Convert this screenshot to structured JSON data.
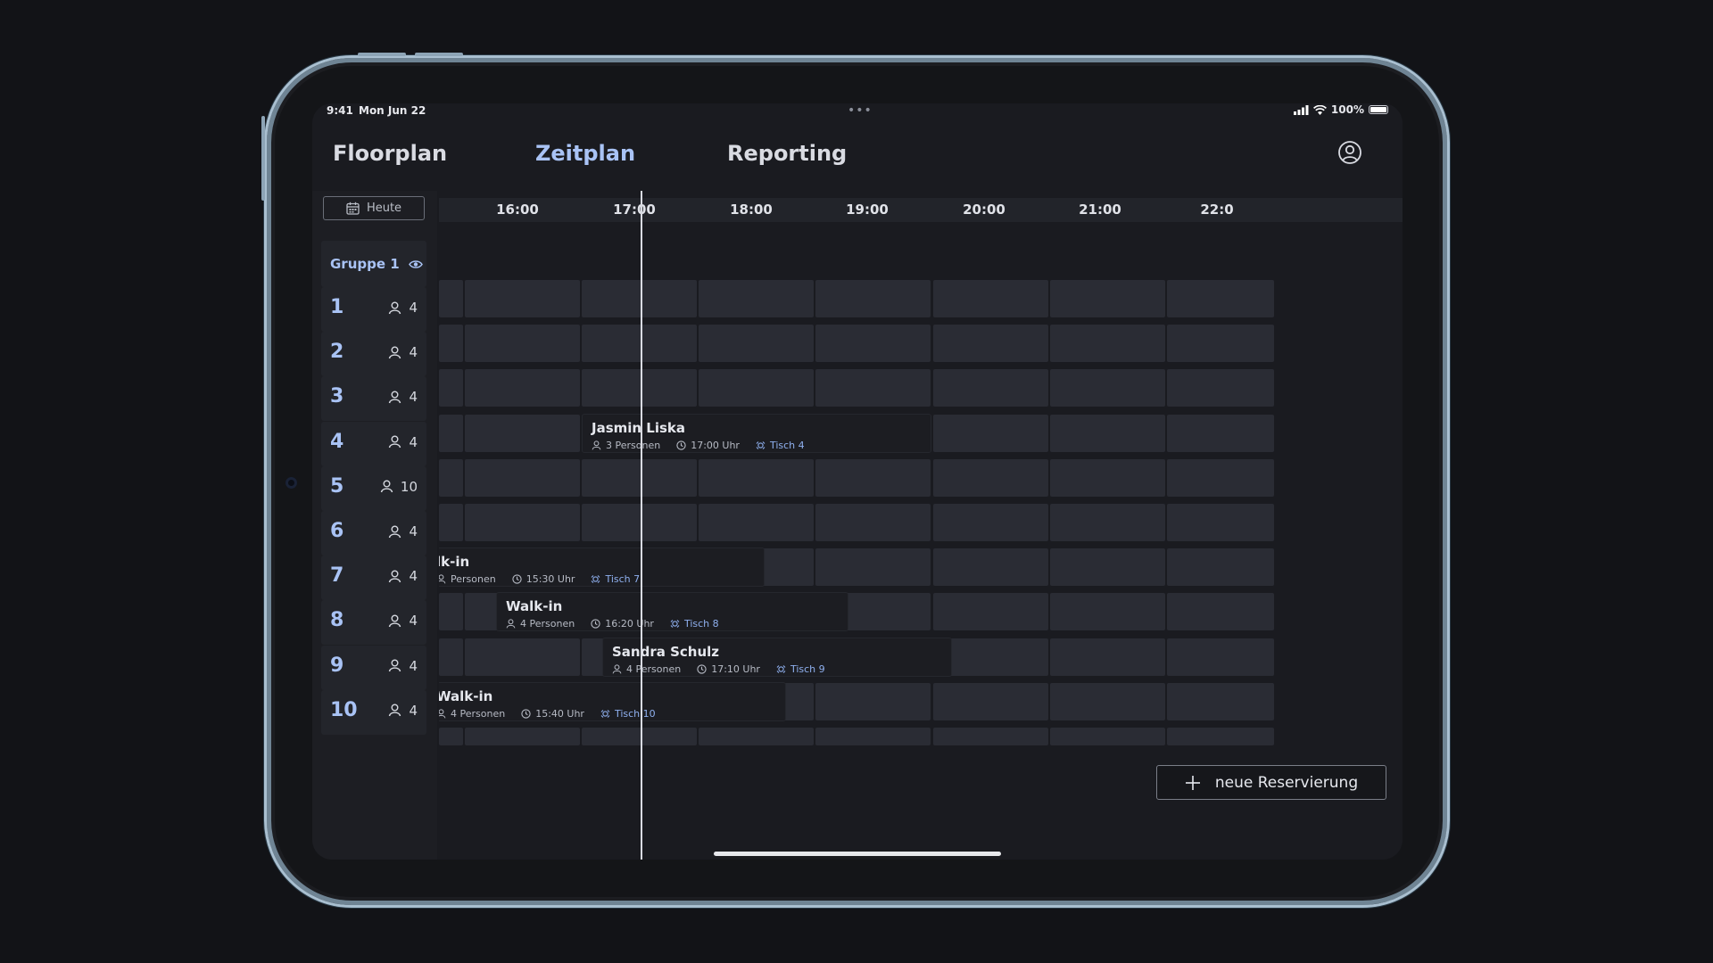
{
  "status": {
    "time": "9:41",
    "date": "Mon Jun 22",
    "battery": "100%"
  },
  "nav": {
    "tabs": [
      "Floorplan",
      "Zeitplan",
      "Reporting"
    ],
    "active": "Zeitplan"
  },
  "toolbar": {
    "today_label": "Heute"
  },
  "group": {
    "label": "Gruppe 1"
  },
  "hours": [
    "16:00",
    "17:00",
    "18:00",
    "19:00",
    "20:00",
    "21:00",
    "22:0"
  ],
  "tables": [
    {
      "num": "1",
      "capacity": "4"
    },
    {
      "num": "2",
      "capacity": "4"
    },
    {
      "num": "3",
      "capacity": "4"
    },
    {
      "num": "4",
      "capacity": "4"
    },
    {
      "num": "5",
      "capacity": "10"
    },
    {
      "num": "6",
      "capacity": "4"
    },
    {
      "num": "7",
      "capacity": "4"
    },
    {
      "num": "8",
      "capacity": "4"
    },
    {
      "num": "9",
      "capacity": "4"
    },
    {
      "num": "10",
      "capacity": "4"
    }
  ],
  "reservations": [
    {
      "name": "Jasmin Liska",
      "persons": "3 Personen",
      "time": "17:00 Uhr",
      "table": "Tisch 4"
    },
    {
      "name": "lk-in",
      "persons": "Personen",
      "time": "15:30 Uhr",
      "table": "Tisch 7"
    },
    {
      "name": "Walk-in",
      "persons": "4 Personen",
      "time": "16:20 Uhr",
      "table": "Tisch 8"
    },
    {
      "name": "Sandra Schulz",
      "persons": "4 Personen",
      "time": "17:10 Uhr",
      "table": "Tisch 9"
    },
    {
      "name": "Walk-in",
      "persons": "4 Personen",
      "time": "15:40 Uhr",
      "table": "Tisch 10"
    }
  ],
  "new_reservation": {
    "label": "neue Reservierung"
  }
}
